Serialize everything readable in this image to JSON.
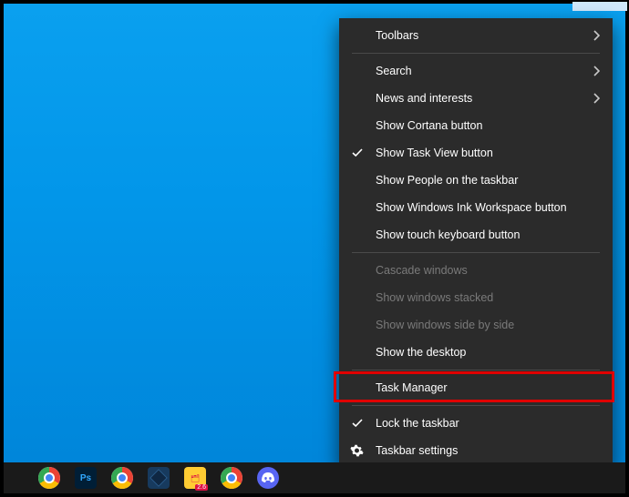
{
  "context_menu": {
    "groups": [
      [
        {
          "id": "toolbars",
          "label": "Toolbars",
          "submenu": true,
          "enabled": true,
          "checked": false,
          "icon": null
        }
      ],
      [
        {
          "id": "search",
          "label": "Search",
          "submenu": true,
          "enabled": true,
          "checked": false,
          "icon": null
        },
        {
          "id": "news",
          "label": "News and interests",
          "submenu": true,
          "enabled": true,
          "checked": false,
          "icon": null
        },
        {
          "id": "show-cortana",
          "label": "Show Cortana button",
          "submenu": false,
          "enabled": true,
          "checked": false,
          "icon": null
        },
        {
          "id": "show-taskview",
          "label": "Show Task View button",
          "submenu": false,
          "enabled": true,
          "checked": true,
          "icon": null
        },
        {
          "id": "show-people",
          "label": "Show People on the taskbar",
          "submenu": false,
          "enabled": true,
          "checked": false,
          "icon": null
        },
        {
          "id": "show-ink",
          "label": "Show Windows Ink Workspace button",
          "submenu": false,
          "enabled": true,
          "checked": false,
          "icon": null
        },
        {
          "id": "show-touchkb",
          "label": "Show touch keyboard button",
          "submenu": false,
          "enabled": true,
          "checked": false,
          "icon": null
        }
      ],
      [
        {
          "id": "cascade",
          "label": "Cascade windows",
          "submenu": false,
          "enabled": false,
          "checked": false,
          "icon": null
        },
        {
          "id": "stacked",
          "label": "Show windows stacked",
          "submenu": false,
          "enabled": false,
          "checked": false,
          "icon": null
        },
        {
          "id": "sidebyside",
          "label": "Show windows side by side",
          "submenu": false,
          "enabled": false,
          "checked": false,
          "icon": null
        },
        {
          "id": "show-desktop",
          "label": "Show the desktop",
          "submenu": false,
          "enabled": true,
          "checked": false,
          "icon": null
        }
      ],
      [
        {
          "id": "task-manager",
          "label": "Task Manager",
          "submenu": false,
          "enabled": true,
          "checked": false,
          "icon": null,
          "highlighted": true
        }
      ],
      [
        {
          "id": "lock-taskbar",
          "label": "Lock the taskbar",
          "submenu": false,
          "enabled": true,
          "checked": true,
          "icon": null
        },
        {
          "id": "taskbar-settings",
          "label": "Taskbar settings",
          "submenu": false,
          "enabled": true,
          "checked": false,
          "icon": "gear"
        }
      ]
    ]
  },
  "taskbar": {
    "apps": [
      {
        "id": "chrome",
        "name": "chrome-icon"
      },
      {
        "id": "photoshop",
        "name": "photoshop-icon",
        "label": "Ps"
      },
      {
        "id": "chrome-canary",
        "name": "chrome-canary-icon"
      },
      {
        "id": "virtualbox",
        "name": "virtualbox-icon"
      },
      {
        "id": "filemanager",
        "name": "filemanager-icon",
        "badge": "2.6"
      },
      {
        "id": "chrome-2",
        "name": "chrome-2-icon"
      },
      {
        "id": "discord",
        "name": "discord-icon"
      }
    ]
  },
  "colors": {
    "desktop_top": "#0aa0ef",
    "desktop_bottom": "#0084d8",
    "menu_bg": "#2b2b2b",
    "menu_text": "#ffffff",
    "menu_disabled": "#7a7a7a",
    "highlight": "#e00000"
  }
}
